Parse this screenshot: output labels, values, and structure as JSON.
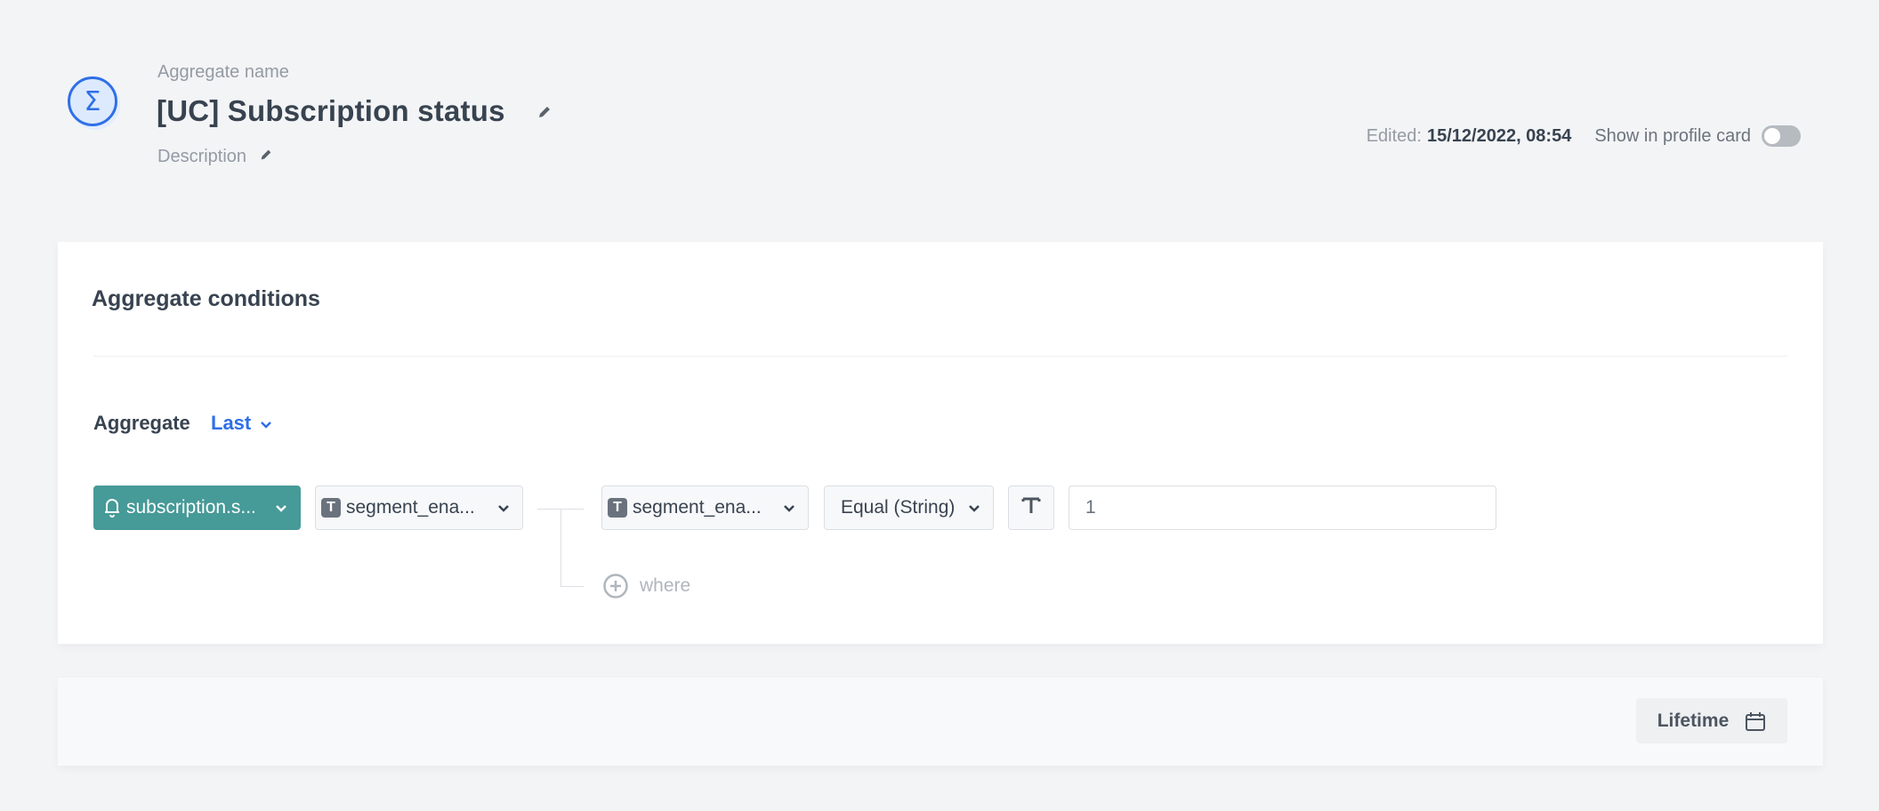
{
  "header": {
    "icon": "sigma-icon",
    "name_label": "Aggregate name",
    "title": "[UC] Subscription status",
    "description_label": "Description",
    "edited_label": "Edited:",
    "edited_value": "15/12/2022, 08:54",
    "show_in_profile_label": "Show in profile card",
    "show_in_profile_enabled": false
  },
  "conditions": {
    "title": "Aggregate conditions",
    "aggregate_label": "Aggregate",
    "aggregate_value": "Last",
    "event_select": {
      "icon": "bell-icon",
      "value": "subscription.s..."
    },
    "parameter_select": {
      "icon": "text-type-icon",
      "value": "segment_ena..."
    },
    "filter_parameter_select": {
      "icon": "text-type-icon",
      "value": "segment_ena..."
    },
    "operator_select": {
      "value": "Equal (String)"
    },
    "value_type_icon": "T",
    "value_input": {
      "value": "1"
    },
    "where_label": "where"
  },
  "footer": {
    "period_label": "Lifetime",
    "period_icon": "calendar-icon"
  },
  "colors": {
    "accent": "#2f6fe8",
    "event_bg": "#469a98",
    "text": "#384350",
    "muted": "#949ba4"
  }
}
